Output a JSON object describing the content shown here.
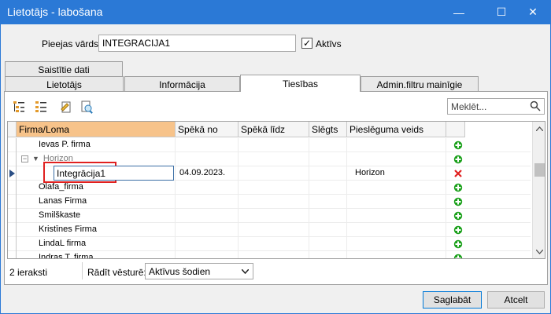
{
  "window": {
    "title": "Lietotājs - labošana",
    "minimize": "—",
    "maximize": "☐",
    "close": "✕"
  },
  "form": {
    "access_name_label": "Pieejas vārds:",
    "access_name_value": "INTEGRACIJA1",
    "active_label": "Aktīvs",
    "active_checked": true
  },
  "tabs": {
    "row_top": [
      "Saistītie dati"
    ],
    "row_bottom": [
      "Lietotājs",
      "Informācija",
      "Tiesības",
      "Admin.filtru mainīgie"
    ],
    "active": "Tiesības"
  },
  "toolbar": {
    "search_placeholder": "Meklēt..."
  },
  "grid": {
    "columns": [
      "Firma/Loma",
      "Spēkā no",
      "Spēkā līdz",
      "Slēgts",
      "Pieslēguma veids"
    ],
    "rows": [
      {
        "firma": "Ievas P. firma",
        "from": "",
        "to": "",
        "closed": "",
        "type": "",
        "action": "add",
        "level": 0
      },
      {
        "firma": "Horizon",
        "from": "",
        "to": "",
        "closed": "",
        "type": "",
        "action": "add",
        "level": 1,
        "group": true
      },
      {
        "firma": "Integrācija1",
        "from": "04.09.2023.",
        "to": "",
        "closed": "",
        "type": "Horizon",
        "action": "remove",
        "level": 2,
        "editing": true
      },
      {
        "firma": "Olafa_firma",
        "from": "",
        "to": "",
        "closed": "",
        "type": "",
        "action": "add",
        "level": 0
      },
      {
        "firma": "Lanas Firma",
        "from": "",
        "to": "",
        "closed": "",
        "type": "",
        "action": "add",
        "level": 0
      },
      {
        "firma": "Smilškaste",
        "from": "",
        "to": "",
        "closed": "",
        "type": "",
        "action": "add",
        "level": 0
      },
      {
        "firma": "Kristīnes Firma",
        "from": "",
        "to": "",
        "closed": "",
        "type": "",
        "action": "add",
        "level": 0
      },
      {
        "firma": "LindaL firma",
        "from": "",
        "to": "",
        "closed": "",
        "type": "",
        "action": "add",
        "level": 0
      },
      {
        "firma": "Indras T. firma",
        "from": "",
        "to": "",
        "closed": "",
        "type": "",
        "action": "add",
        "level": 0
      }
    ]
  },
  "status": {
    "record_count": "2 ieraksti",
    "history_label": "Rādīt vēsturē:",
    "history_value": "Aktīvus šodien"
  },
  "buttons": {
    "save": "Saglabāt",
    "cancel": "Atcelt"
  },
  "colors": {
    "titlebar": "#2b79d6",
    "header_active": "#f7c38a",
    "add_icon": "#1aa01a",
    "remove_icon": "#e0201f",
    "highlight_box": "#e0201f"
  }
}
